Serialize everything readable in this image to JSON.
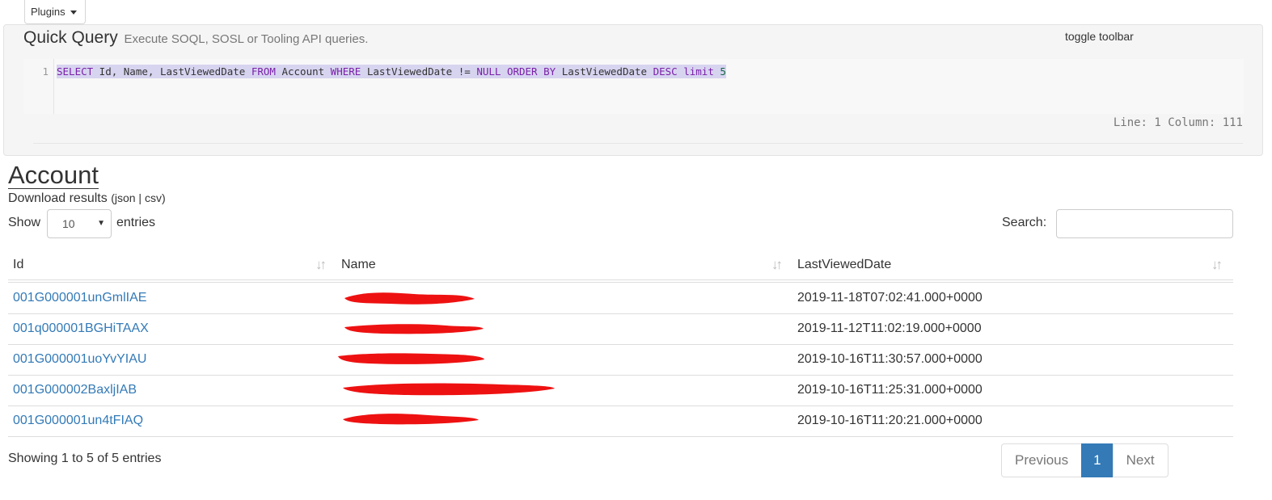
{
  "plugins": {
    "label": "Plugins"
  },
  "quick_query": {
    "title": "Quick Query",
    "subtitle": "Execute SOQL, SOSL or Tooling API queries.",
    "toggle_toolbar": "toggle toolbar",
    "line_number": "1",
    "tokens": {
      "select": "SELECT",
      "fields": " Id, Name, LastViewedDate ",
      "from": "FROM",
      "object": " Account ",
      "where": "WHERE",
      "cond": " LastViewedDate != ",
      "null": "NULL",
      "order_by": "ORDER BY",
      "order_field": " LastViewedDate ",
      "desc": "DESC",
      "limit": "limit",
      "limit_value": "5"
    },
    "status": "Line: 1 Column: 111"
  },
  "results": {
    "heading": "Account",
    "download_label": "Download results",
    "download_json": "json",
    "download_csv": "csv",
    "show_label": "Show",
    "page_size": "10",
    "entries_label": "entries",
    "search_label": "Search:",
    "search_value": "",
    "columns": [
      "Id",
      "Name",
      "LastViewedDate"
    ],
    "rows": [
      {
        "id": "001G000001unGmlIAE",
        "date": "2019-11-18T07:02:41.000+0000"
      },
      {
        "id": "001q000001BGHiTAAX",
        "date": "2019-11-12T11:02:19.000+0000"
      },
      {
        "id": "001G000001uoYvYIAU",
        "date": "2019-10-16T11:30:57.000+0000"
      },
      {
        "id": "001G000002BaxljIAB",
        "date": "2019-10-16T11:25:31.000+0000"
      },
      {
        "id": "001G000001un4tFIAQ",
        "date": "2019-10-16T11:20:21.000+0000"
      }
    ],
    "info": "Showing 1 to 5 of 5 entries",
    "pagination": {
      "previous": "Previous",
      "current": "1",
      "next": "Next"
    }
  },
  "colors": {
    "link": "#337ab7",
    "redaction": "#ee1111",
    "keyword": "#7a1fa8"
  }
}
